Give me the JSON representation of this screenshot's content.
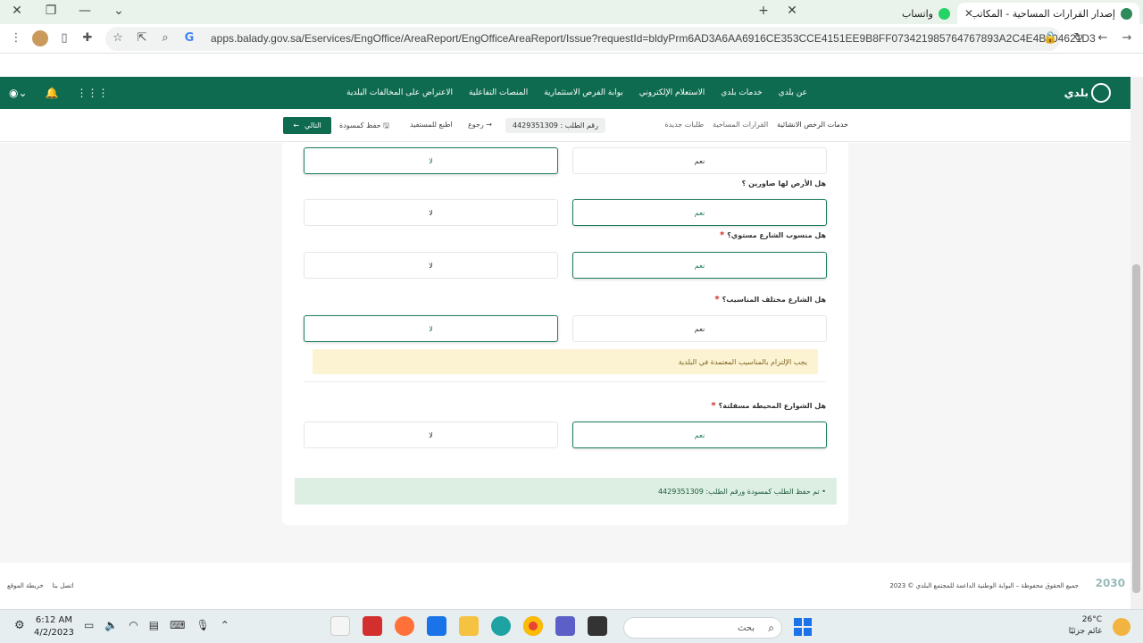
{
  "browser": {
    "active_tab_title": "إصدار القرارات المساحية - المكاتب",
    "other_tab_title": "واتساب",
    "url": "apps.balady.gov.sa/Eservices/EngOffice/AreaReport/EngOfficeAreaReport/Issue?requestId=bldyPrm6AD3A6AA6916CE353CCE4151EE9B8FF073421985764767893A2C4E4B004621D3"
  },
  "header": {
    "logo_text": "بلدي",
    "nav": [
      "عن بلدي",
      "خدمات بلدي",
      "الاستعلام الإلكتروني",
      "بوابة الفرص الاستثمارية",
      "المنصات التفاعلية",
      "الاعتراض على المخالفات البلدية"
    ]
  },
  "subbar": {
    "breadcrumbs": [
      "خدمات الرخص الانشائية",
      "القرارات المساحية",
      "طلبات جديدة"
    ],
    "request_number": "رقم الطلب : 4429351309",
    "back_label": "رجوع",
    "print_label": "اطبع للمستفيد",
    "save_draft_label": "حفظ كمسودة",
    "next_label": "التالي"
  },
  "form": {
    "yes_label": "نعم",
    "no_label": "لا",
    "q1": "هل الأرض لها صاورين ؟",
    "q2": "هل منسوب الشارع مستوي؟",
    "q3": "هل الشارع مختلف المناسيب؟",
    "q4": "هل الشوارع المحيطة مسفلتة؟",
    "required_mark": "*",
    "warning": "يجب الإلتزام بالمناسيب المعتمدة في البلدية",
    "success": "• تم حفظ الطلب كمسودة ورقم الطلب: 4429351309"
  },
  "footer": {
    "copyright": "جميع الحقوق محفوظة – البوابة الوطنية الداعمة للمجتمع البلدي © 2023",
    "links": [
      "خريطة الموقع",
      "اتصل بنا"
    ],
    "vision": "2030"
  },
  "taskbar": {
    "time": "6:12 AM",
    "date": "4/2/2023",
    "search_placeholder": "بحث",
    "temperature": "26°C",
    "weather": "غائم جزئيًا"
  },
  "colors": {
    "brand_green": "#0f6b4f",
    "selected_border": "#1b7d5c",
    "warning_bg": "#fcf3d2",
    "success_bg": "#dcefe2",
    "required": "#d62828"
  }
}
